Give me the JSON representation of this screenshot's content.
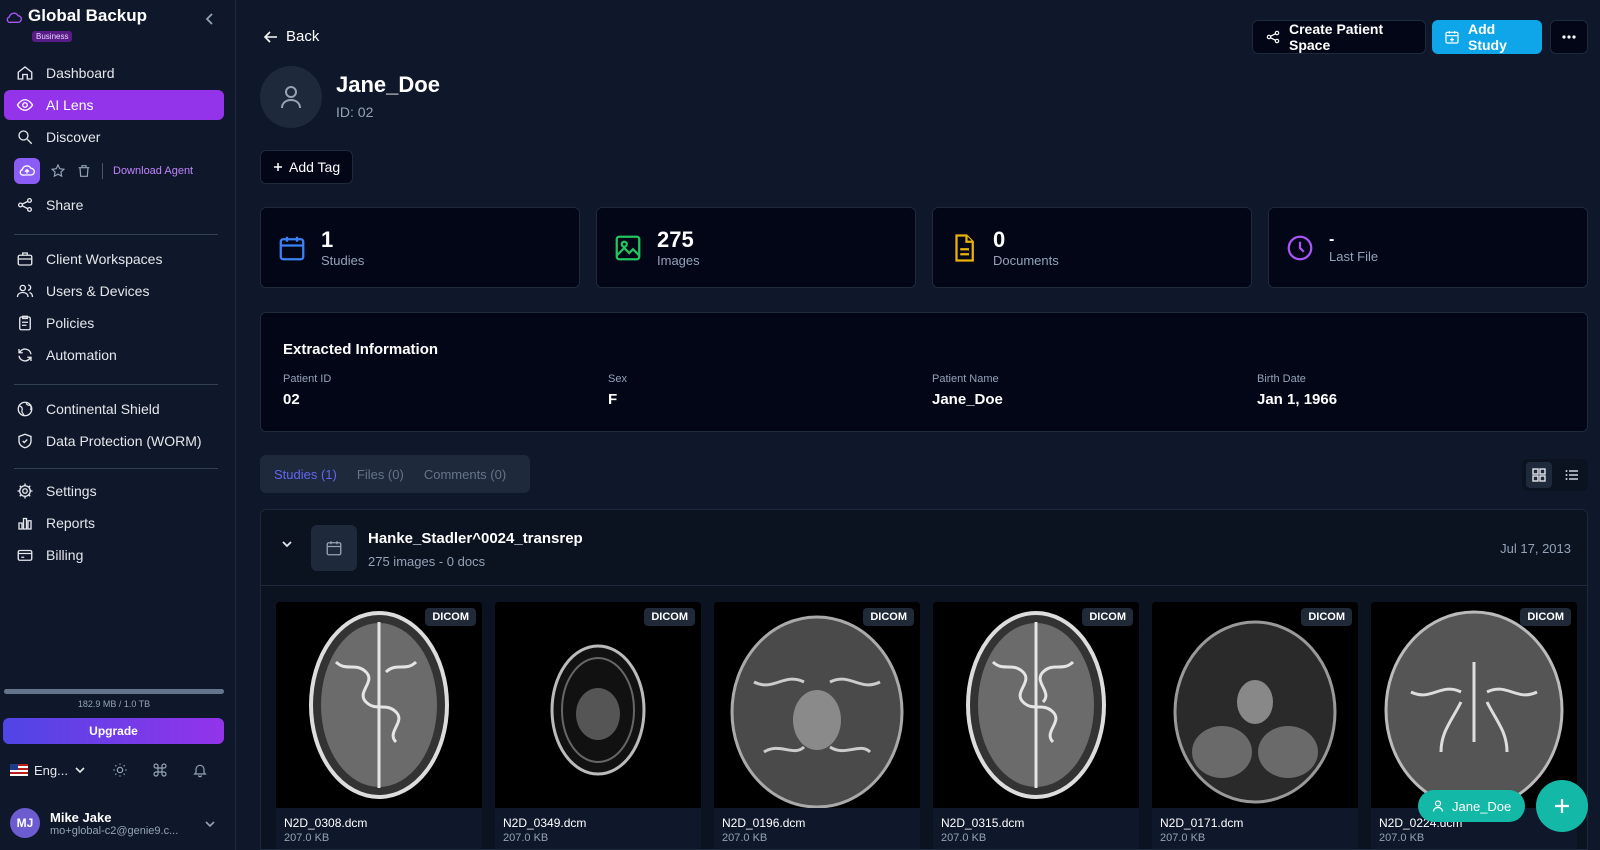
{
  "app": {
    "title": "Global Backup",
    "badge": "Business"
  },
  "sidebar": {
    "items": [
      {
        "label": "Dashboard"
      },
      {
        "label": "AI Lens"
      },
      {
        "label": "Discover"
      },
      {
        "label": "Share"
      },
      {
        "label": "Client Workspaces"
      },
      {
        "label": "Users & Devices"
      },
      {
        "label": "Policies"
      },
      {
        "label": "Automation"
      },
      {
        "label": "Continental Shield"
      },
      {
        "label": "Data Protection (WORM)"
      },
      {
        "label": "Settings"
      },
      {
        "label": "Reports"
      },
      {
        "label": "Billing"
      }
    ],
    "active": "AI Lens",
    "download_agent": "Download Agent",
    "storage": {
      "text": "182.9 MB / 1.0 TB",
      "used_fraction": 0.0002
    },
    "upgrade": "Upgrade",
    "language": "Eng...",
    "user": {
      "initials": "MJ",
      "name": "Mike Jake",
      "email": "mo+global-c2@genie9.c..."
    }
  },
  "header": {
    "back": "Back",
    "create_patient_space": "Create Patient Space",
    "add_study": "Add Study"
  },
  "patient": {
    "name": "Jane_Doe",
    "id_text": "ID: 02",
    "add_tag": "Add Tag"
  },
  "stats": [
    {
      "value": "1",
      "label": "Studies",
      "color": "#3b82f6"
    },
    {
      "value": "275",
      "label": "Images",
      "color": "#22c55e"
    },
    {
      "value": "0",
      "label": "Documents",
      "color": "#eab308"
    },
    {
      "value": "-",
      "label": "Last File",
      "color": "#a855f7"
    }
  ],
  "extracted": {
    "title": "Extracted Information",
    "fields": [
      {
        "label": "Patient ID",
        "value": "02"
      },
      {
        "label": "Sex",
        "value": "F"
      },
      {
        "label": "Patient Name",
        "value": "Jane_Doe"
      },
      {
        "label": "Birth Date",
        "value": "Jan 1, 1966"
      }
    ]
  },
  "tabs": [
    {
      "label": "Studies (1)"
    },
    {
      "label": "Files (0)"
    },
    {
      "label": "Comments (0)"
    }
  ],
  "study": {
    "title": "Hanke_Stadler^0024_transrep",
    "subtitle": "275 images - 0 docs",
    "date": "Jul 17, 2013",
    "files": [
      {
        "name": "N2D_0308.dcm",
        "size": "207.0 KB",
        "badge": "DICOM"
      },
      {
        "name": "N2D_0349.dcm",
        "size": "207.0 KB",
        "badge": "DICOM"
      },
      {
        "name": "N2D_0196.dcm",
        "size": "207.0 KB",
        "badge": "DICOM"
      },
      {
        "name": "N2D_0315.dcm",
        "size": "207.0 KB",
        "badge": "DICOM"
      },
      {
        "name": "N2D_0171.dcm",
        "size": "207.0 KB",
        "badge": "DICOM"
      },
      {
        "name": "N2D_0224.dcm",
        "size": "207.0 KB",
        "badge": "DICOM"
      }
    ]
  },
  "floating": {
    "patient_chip": "Jane_Doe"
  }
}
